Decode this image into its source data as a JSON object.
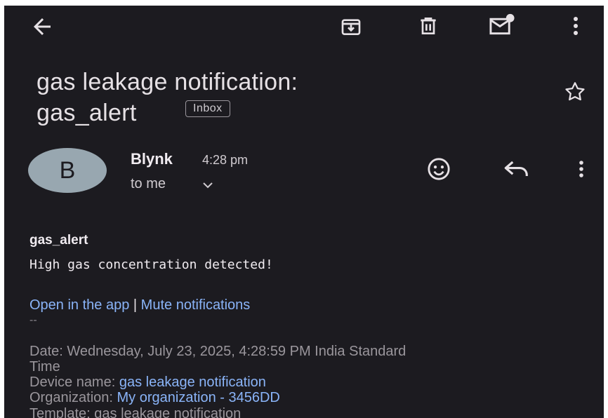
{
  "toolbar": {
    "back": "back-arrow-icon",
    "archive": "archive-icon",
    "delete": "delete-icon",
    "mark_unread": "mark-unread-icon",
    "more": "more-vert-icon"
  },
  "email": {
    "subject_line1": "gas leakage notification:",
    "subject_line2": "gas_alert",
    "label": "Inbox",
    "sender": {
      "avatar_letter": "B",
      "avatar_color": "#98a7b0",
      "name": "Blynk",
      "time": "4:28 pm",
      "recipient": "to me",
      "recipient_chevron": "⌄"
    },
    "body": {
      "title": "gas_alert",
      "message": "High gas concentration detected!",
      "open_app_link": "Open in the app",
      "link_separator": "|",
      "mute_link": "Mute notifications",
      "dashes": "--",
      "date_line": "Date: Wednesday, July 23, 2025, 4:28:59 PM India Standard",
      "date_line_wrap": "Time",
      "device_label": "Device name: ",
      "device_value": "gas leakage notification",
      "org_label": "Organization: ",
      "org_value": "My organization - 3456DD",
      "template_line": "Template: gas leakage notification"
    }
  },
  "colors": {
    "background": "#1c1b20",
    "link": "#8ab4f8",
    "text": "#e6e1e5",
    "muted": "#9a969c"
  }
}
